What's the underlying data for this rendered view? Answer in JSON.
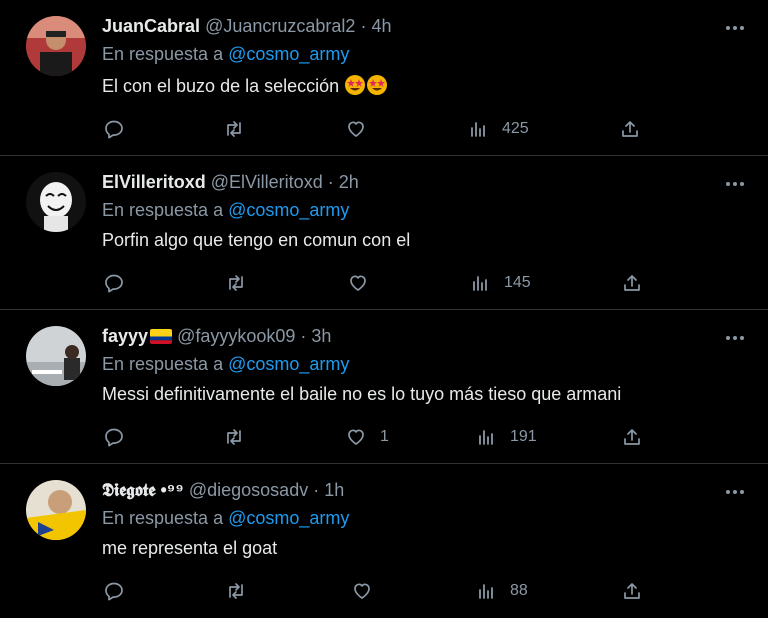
{
  "tweets": [
    {
      "name": "JuanCabral",
      "handle": "@Juancruzcabral2",
      "time": "4h",
      "reply_prefix": "En respuesta a",
      "reply_to": "@cosmo_army",
      "text": "El con el buzo de la selección",
      "emoji": "star-struck-emoji",
      "likes": "",
      "views": "425"
    },
    {
      "name": "ElVilleritoxd",
      "handle": "@ElVilleritoxd",
      "time": "2h",
      "reply_prefix": "En respuesta a",
      "reply_to": "@cosmo_army",
      "text": "Porfin algo que tengo en comun con el",
      "likes": "",
      "views": "145"
    },
    {
      "name": "fayyy",
      "handle": "@fayyykook09",
      "time": "3h",
      "reply_prefix": "En respuesta a",
      "reply_to": "@cosmo_army",
      "text": "Messi definitivamente el baile no es lo tuyo más tieso que armani",
      "flag": "colombia-flag-emoji",
      "likes": "1",
      "views": "191"
    },
    {
      "name": "𝕯𝖎𝖊𝖌𝖔𝖙𝖊 •⁹⁹",
      "handle": "@diegososadv",
      "time": "1h",
      "reply_prefix": "En respuesta a",
      "reply_to": "@cosmo_army",
      "text": "me representa el goat",
      "likes": "",
      "views": "88"
    }
  ],
  "colors": {
    "background": "#000000",
    "text": "#e7e9ea",
    "secondary": "#8b98a5",
    "mention": "#1d9bf0",
    "divider": "#2f3336"
  }
}
